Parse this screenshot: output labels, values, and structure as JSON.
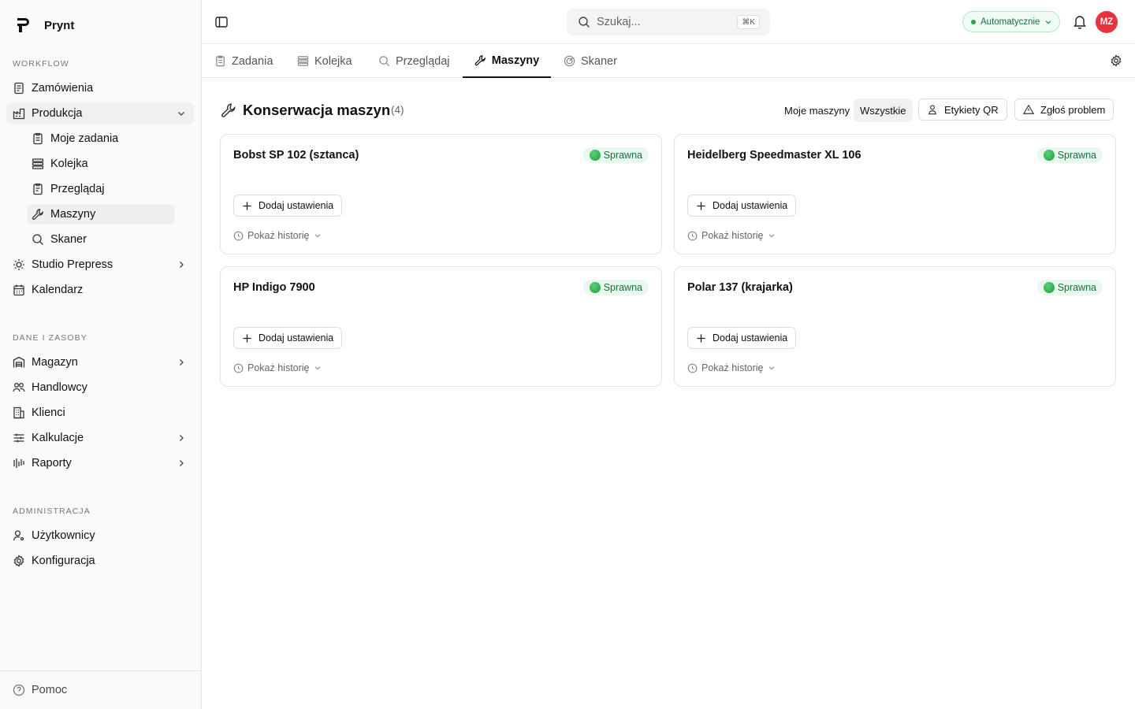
{
  "brand": {
    "name": "Prynt"
  },
  "sidebar": {
    "sections": [
      "Workflow",
      "Dane i zasoby",
      "Administracja"
    ],
    "workflow": [
      {
        "label": "Zamówienia"
      },
      {
        "label": "Produkcja"
      },
      {
        "label": "Studio Prepress"
      },
      {
        "label": "Kalendarz"
      }
    ],
    "produkcja_sub": [
      {
        "label": "Moje zadania"
      },
      {
        "label": "Kolejka"
      },
      {
        "label": "Przeglądaj"
      },
      {
        "label": "Maszyny"
      },
      {
        "label": "Skaner"
      }
    ],
    "dane": [
      {
        "label": "Magazyn"
      },
      {
        "label": "Handlowcy"
      },
      {
        "label": "Klienci"
      },
      {
        "label": "Kalkulacje"
      },
      {
        "label": "Raporty"
      }
    ],
    "admin": [
      {
        "label": "Użytkownicy"
      },
      {
        "label": "Konfiguracja"
      }
    ],
    "help": "Pomoc"
  },
  "topbar": {
    "search_placeholder": "Szukaj...",
    "shortcut": "⌘K",
    "mode": "Automatycznie",
    "avatar": "MZ"
  },
  "tabs": [
    {
      "label": "Zadania"
    },
    {
      "label": "Kolejka"
    },
    {
      "label": "Przeglądaj"
    },
    {
      "label": "Maszyny"
    },
    {
      "label": "Skaner"
    }
  ],
  "page": {
    "title": "Konserwacja maszyn",
    "count": "(4)",
    "filters": [
      "Moje maszyny",
      "Wszystkie"
    ],
    "qr_button": "Etykiety QR",
    "report_button": "Zgłoś problem"
  },
  "machines": [
    {
      "name": "Bobst SP 102 (sztanca)",
      "status": "Sprawna",
      "add": "Dodaj ustawienia",
      "history": "Pokaż historię"
    },
    {
      "name": "Heidelberg Speedmaster XL 106",
      "status": "Sprawna",
      "add": "Dodaj ustawienia",
      "history": "Pokaż historię"
    },
    {
      "name": "HP Indigo 7900",
      "status": "Sprawna",
      "add": "Dodaj ustawienia",
      "history": "Pokaż historię"
    },
    {
      "name": "Polar 137 (krajarka)",
      "status": "Sprawna",
      "add": "Dodaj ustawienia",
      "history": "Pokaż historię"
    }
  ]
}
